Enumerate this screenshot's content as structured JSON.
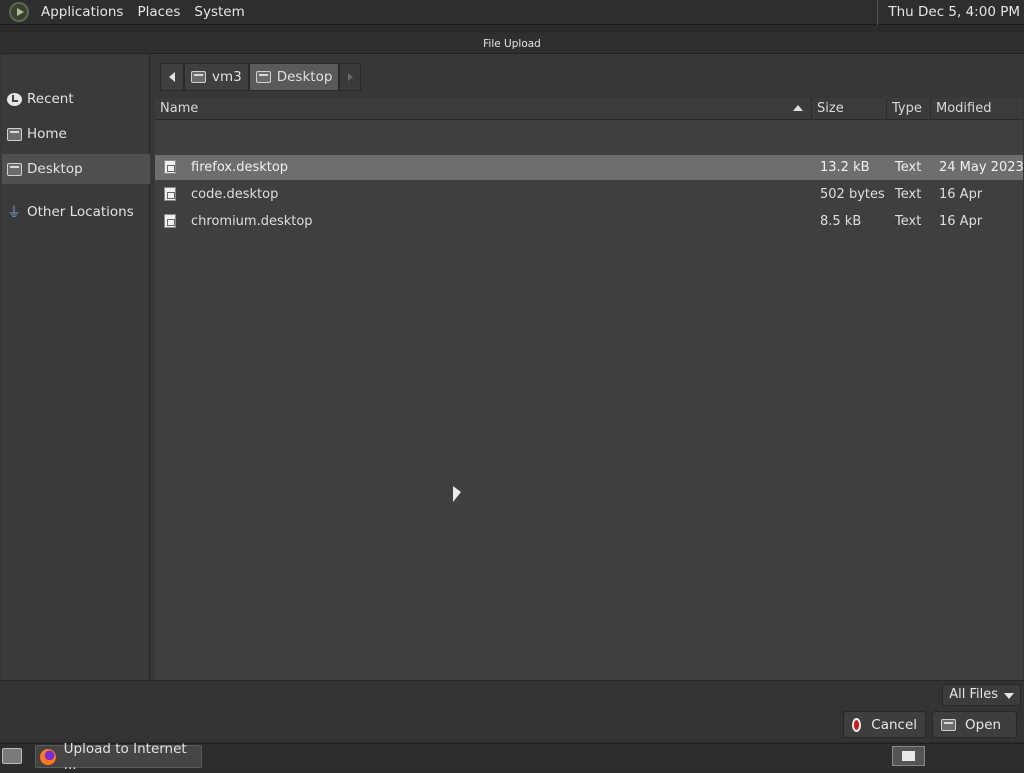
{
  "top_panel": {
    "menus": [
      "Applications",
      "Places",
      "System"
    ],
    "clock": "Thu Dec  5,  4:00 PM"
  },
  "dialog": {
    "title": "File Upload",
    "sidebar": {
      "items": [
        {
          "label": "Recent",
          "icon": "recent-icon"
        },
        {
          "label": "Home",
          "icon": "folder-icon"
        },
        {
          "label": "Desktop",
          "icon": "folder-icon",
          "selected": true
        },
        {
          "label": "Other Locations",
          "icon": "network-icon"
        }
      ]
    },
    "pathbar": {
      "segments": [
        "vm3",
        "Desktop"
      ],
      "active": "Desktop"
    },
    "columns": {
      "name": "Name",
      "size": "Size",
      "type": "Type",
      "modified": "Modified"
    },
    "files": [
      {
        "name": "firefox.desktop",
        "size": "13.2 kB",
        "type": "Text",
        "modified": "24 May 2023",
        "selected": true
      },
      {
        "name": "code.desktop",
        "size": "502 bytes",
        "type": "Text",
        "modified": "16 Apr"
      },
      {
        "name": "chromium.desktop",
        "size": "8.5 kB",
        "type": "Text",
        "modified": "16 Apr"
      }
    ],
    "filter": "All Files",
    "buttons": {
      "cancel": "Cancel",
      "open": "Open"
    }
  },
  "taskbar": {
    "task_label": "Upload to Internet ..."
  }
}
